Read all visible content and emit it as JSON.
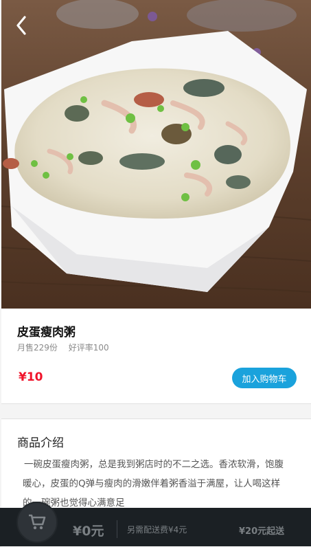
{
  "header": {
    "back_icon": "chevron-left-icon"
  },
  "product": {
    "name": "皮蛋瘦肉粥",
    "monthly_sales": "月售229份",
    "rating": "好评率100",
    "price": "¥10",
    "add_to_cart_label": "加入购物车",
    "accent_color": "#1aa2dc",
    "price_color": "#f0142b"
  },
  "intro": {
    "title": "商品介绍",
    "text": "一碗皮蛋瘦肉粥，总是我到粥店时的不二之选。香浓软滑，饱腹暖心，皮蛋的Q弹与瘦肉的滑嫩伴着粥香溢于满屋，让人喝这样的一碗粥也觉得心满意足"
  },
  "cart": {
    "icon": "cart-icon",
    "total": "¥0元",
    "delivery_fee": "另需配送费¥4元",
    "minimum_order": "¥20元起送"
  }
}
